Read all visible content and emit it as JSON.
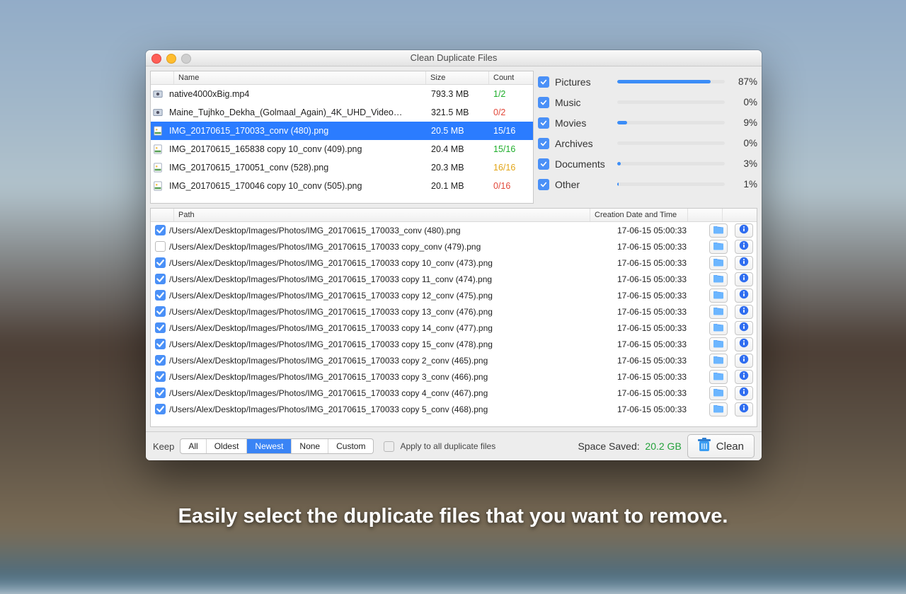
{
  "window_title": "Clean Duplicate Files",
  "columns": {
    "name": "Name",
    "size": "Size",
    "count": "Count",
    "path": "Path",
    "date": "Creation Date and Time"
  },
  "files": [
    {
      "icon": "video",
      "name": "native4000xBig.mp4",
      "size": "793.3 MB",
      "count": "1/2",
      "cc": "green"
    },
    {
      "icon": "video",
      "name": "Maine_Tujhko_Dekha_(Golmaal_Again)_4K_UHD_Video…",
      "size": "321.5 MB",
      "count": "0/2",
      "cc": "red"
    },
    {
      "icon": "png",
      "name": "IMG_20170615_170033_conv (480).png",
      "size": "20.5 MB",
      "count": "15/16",
      "cc": "green",
      "selected": true
    },
    {
      "icon": "png",
      "name": "IMG_20170615_165838 copy 10_conv (409).png",
      "size": "20.4 MB",
      "count": "15/16",
      "cc": "green"
    },
    {
      "icon": "png",
      "name": "IMG_20170615_170051_conv (528).png",
      "size": "20.3 MB",
      "count": "16/16",
      "cc": "yellow"
    },
    {
      "icon": "png",
      "name": "IMG_20170615_170046 copy 10_conv (505).png",
      "size": "20.1 MB",
      "count": "0/16",
      "cc": "red"
    }
  ],
  "categories": [
    {
      "name": "Pictures",
      "pct": 87
    },
    {
      "name": "Music",
      "pct": 0
    },
    {
      "name": "Movies",
      "pct": 9
    },
    {
      "name": "Archives",
      "pct": 0
    },
    {
      "name": "Documents",
      "pct": 3
    },
    {
      "name": "Other",
      "pct": 1
    }
  ],
  "paths": [
    {
      "checked": true,
      "path": "/Users/Alex/Desktop/Images/Photos/IMG_20170615_170033_conv (480).png",
      "date": "17-06-15 05:00:33"
    },
    {
      "checked": false,
      "path": "/Users/Alex/Desktop/Images/Photos/IMG_20170615_170033 copy_conv (479).png",
      "date": "17-06-15 05:00:33"
    },
    {
      "checked": true,
      "path": "/Users/Alex/Desktop/Images/Photos/IMG_20170615_170033 copy 10_conv (473).png",
      "date": "17-06-15 05:00:33"
    },
    {
      "checked": true,
      "path": "/Users/Alex/Desktop/Images/Photos/IMG_20170615_170033 copy 11_conv (474).png",
      "date": "17-06-15 05:00:33"
    },
    {
      "checked": true,
      "path": "/Users/Alex/Desktop/Images/Photos/IMG_20170615_170033 copy 12_conv (475).png",
      "date": "17-06-15 05:00:33"
    },
    {
      "checked": true,
      "path": "/Users/Alex/Desktop/Images/Photos/IMG_20170615_170033 copy 13_conv (476).png",
      "date": "17-06-15 05:00:33"
    },
    {
      "checked": true,
      "path": "/Users/Alex/Desktop/Images/Photos/IMG_20170615_170033 copy 14_conv (477).png",
      "date": "17-06-15 05:00:33"
    },
    {
      "checked": true,
      "path": "/Users/Alex/Desktop/Images/Photos/IMG_20170615_170033 copy 15_conv (478).png",
      "date": "17-06-15 05:00:33"
    },
    {
      "checked": true,
      "path": "/Users/Alex/Desktop/Images/Photos/IMG_20170615_170033 copy 2_conv (465).png",
      "date": "17-06-15 05:00:33"
    },
    {
      "checked": true,
      "path": "/Users/Alex/Desktop/Images/Photos/IMG_20170615_170033 copy 3_conv (466).png",
      "date": "17-06-15 05:00:33"
    },
    {
      "checked": true,
      "path": "/Users/Alex/Desktop/Images/Photos/IMG_20170615_170033 copy 4_conv (467).png",
      "date": "17-06-15 05:00:33"
    },
    {
      "checked": true,
      "path": "/Users/Alex/Desktop/Images/Photos/IMG_20170615_170033 copy 5_conv (468).png",
      "date": "17-06-15 05:00:33"
    }
  ],
  "keep": {
    "label": "Keep",
    "options": [
      "All",
      "Oldest",
      "Newest",
      "None",
      "Custom"
    ],
    "selected": 2,
    "apply_label": "Apply to all duplicate files"
  },
  "space_saved": {
    "label": "Space Saved:",
    "value": "20.2 GB"
  },
  "clean_label": "Clean",
  "caption": "Easily select the duplicate files that you want to remove."
}
